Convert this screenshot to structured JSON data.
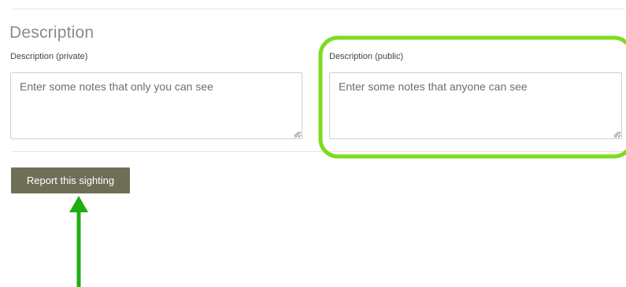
{
  "form": {
    "section_title": "Description",
    "private_field": {
      "label": "Description (private)",
      "placeholder": "Enter some notes that only you can see",
      "value": ""
    },
    "public_field": {
      "label": "Description (public)",
      "placeholder": "Enter some notes that anyone can see",
      "value": ""
    },
    "submit_label": "Report this sighting"
  },
  "annotations": {
    "highlight_color": "#7ddc1f",
    "arrow_color": "#1fad14"
  },
  "colors": {
    "button_bg": "#6f6f58",
    "button_text": "#ffffff",
    "heading": "#8a8a8a"
  }
}
